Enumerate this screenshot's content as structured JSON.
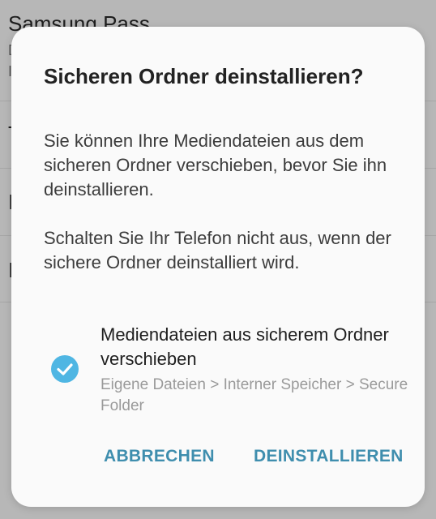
{
  "background": {
    "title": "Samsung Pass",
    "sub_line_1": "D",
    "sub_line_2": "I",
    "item_1": "T",
    "item_2": "I",
    "item_3": "I"
  },
  "dialog": {
    "title": "Sicheren Ordner deinstallieren?",
    "paragraph_1": "Sie können Ihre Mediendateien aus dem sicheren Ordner verschieben, bevor Sie ihn deinstallieren.",
    "paragraph_2": "Schalten Sie Ihr Telefon nicht aus, wenn der sichere Ordner deinstalliert wird.",
    "option": {
      "checked": true,
      "label": "Mediendateien aus sicherem Ordner verschieben",
      "path": "Eigene Dateien > Interner Speicher > Secure Folder",
      "icon": "check-circle-icon"
    },
    "buttons": {
      "cancel": "ABBRECHEN",
      "uninstall": "DEINSTALLIEREN"
    }
  },
  "colors": {
    "accent": "#3f8eae",
    "checkbox": "#4fb6e3",
    "scrim": "#b7b7b7"
  }
}
